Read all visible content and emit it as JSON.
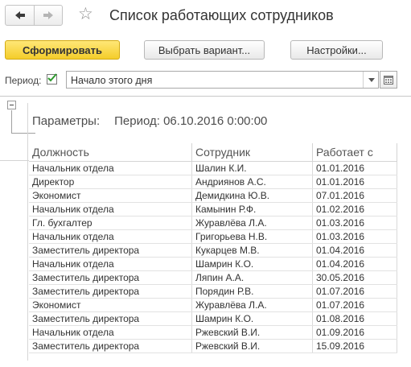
{
  "header": {
    "title": "Список работающих сотрудников",
    "back_icon": "arrow-left-icon",
    "forward_icon": "arrow-right-icon",
    "favorite_icon": "star-icon"
  },
  "toolbar": {
    "generate_label": "Сформировать",
    "choose_variant_label": "Выбрать вариант...",
    "settings_label": "Настройки..."
  },
  "period": {
    "label": "Период:",
    "checked": true,
    "value": "Начало этого дня"
  },
  "report": {
    "params_label": "Параметры:",
    "params_value": "Период: 06.10.2016 0:00:00",
    "columns": [
      "Должность",
      "Сотрудник",
      "Работает с"
    ],
    "rows": [
      [
        "Начальник отдела",
        "Шалин К.И.",
        "01.01.2016"
      ],
      [
        "Директор",
        "Андриянов А.С.",
        "01.01.2016"
      ],
      [
        "Экономист",
        "Демидкина Ю.В.",
        "07.01.2016"
      ],
      [
        "Начальник отдела",
        "Камынин Р.Ф.",
        "01.02.2016"
      ],
      [
        "Гл. бухгалтер",
        "Журавлёва Л.А.",
        "01.03.2016"
      ],
      [
        "Начальник отдела",
        "Григорьева Н.В.",
        "01.03.2016"
      ],
      [
        "Заместитель директора",
        "Кукарцев М.В.",
        "01.04.2016"
      ],
      [
        "Начальник отдела",
        "Шамрин К.О.",
        "01.04.2016"
      ],
      [
        "Заместитель директора",
        "Ляпин А.А.",
        "30.05.2016"
      ],
      [
        "Заместитель директора",
        "Порядин Р.В.",
        "01.07.2016"
      ],
      [
        "Экономист",
        "Журавлёва Л.А.",
        "01.07.2016"
      ],
      [
        "Заместитель директора",
        "Шамрин К.О.",
        "01.08.2016"
      ],
      [
        "Начальник отдела",
        "Ржевский В.И.",
        "01.09.2016"
      ],
      [
        "Заместитель директора",
        "Ржевский В.И.",
        "15.09.2016"
      ]
    ]
  },
  "colors": {
    "primary_button": "#f4cd2a",
    "checkbox_check": "#2e9a2e",
    "border": "#b8b8b8"
  }
}
